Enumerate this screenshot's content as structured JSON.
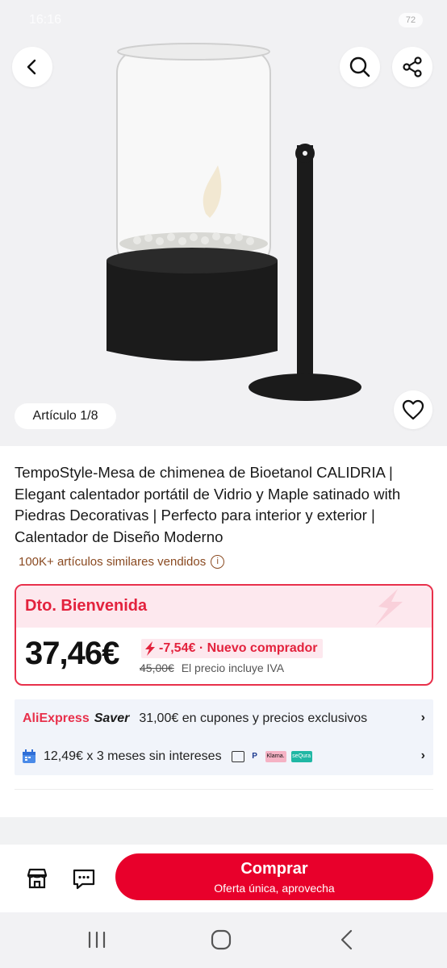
{
  "status": {
    "time": "16:16",
    "battery": "72"
  },
  "gallery": {
    "counter": "Artículo 1/8"
  },
  "product": {
    "title": "TempoStyle-Mesa de chimenea de Bioetanol CALIDRIA | Elegant calentador portátil de Vidrio y Maple satinado with Piedras Decorativas | Perfecto para interior y exterior | Calentador de Diseño Moderno",
    "sold": "100K+ artículos similares vendidos",
    "sold_info_icon": "info-circle-icon"
  },
  "price_card": {
    "label": "Dto. Bienvenida",
    "price": "37,46€",
    "discount": "-7,54€ · Nuevo comprador",
    "old_price": "45,00€",
    "tax_note": "El precio incluye IVA"
  },
  "saver": {
    "brand_ali": "AliExpress",
    "brand_saver": "Saver",
    "text": "31,00€ en cupones y precios exclusivos"
  },
  "installments": {
    "text": "12,49€ x 3 meses sin intereses",
    "payment_methods": [
      "card-icon",
      "PayPal",
      "Klarna.",
      "seQura"
    ]
  },
  "action_bar": {
    "buy_label": "Comprar",
    "buy_sub": "Oferta única, aprovecha"
  },
  "colors": {
    "accent": "#e8002b",
    "price_pink": "#fde8ee",
    "sold_brown": "#8a4a21"
  }
}
